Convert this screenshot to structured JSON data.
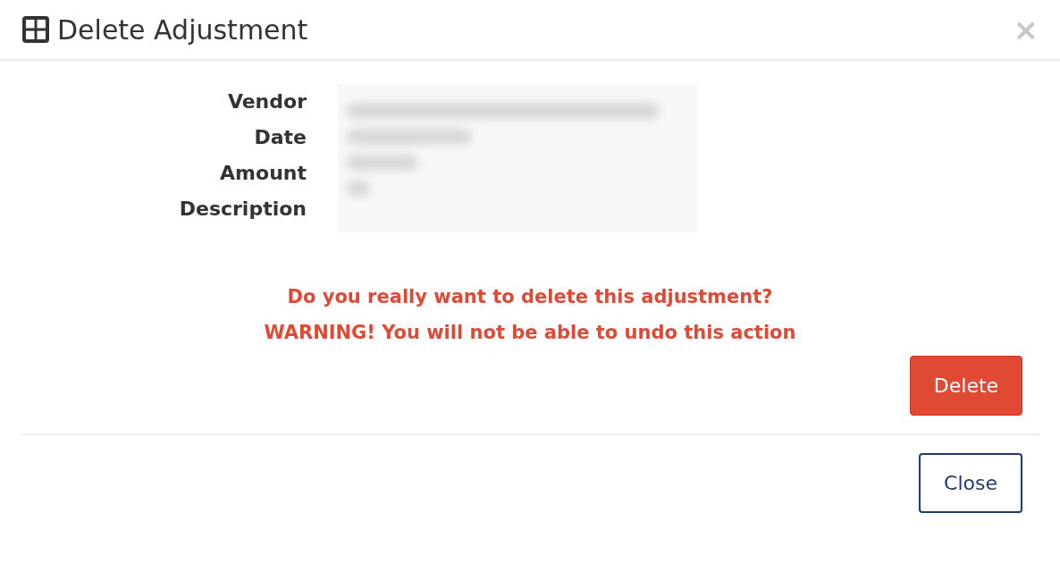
{
  "modal": {
    "title": "Delete Adjustment",
    "close_symbol": "×"
  },
  "fields": [
    {
      "label": "Vendor"
    },
    {
      "label": "Date"
    },
    {
      "label": "Amount"
    },
    {
      "label": "Description"
    }
  ],
  "warning": [
    "Do you really want to delete this adjustment?",
    "WARNING! You will not be able to undo this action"
  ],
  "buttons": [
    {
      "label": "Delete",
      "kind": "danger"
    },
    {
      "label": "Close",
      "kind": "outline"
    }
  ]
}
